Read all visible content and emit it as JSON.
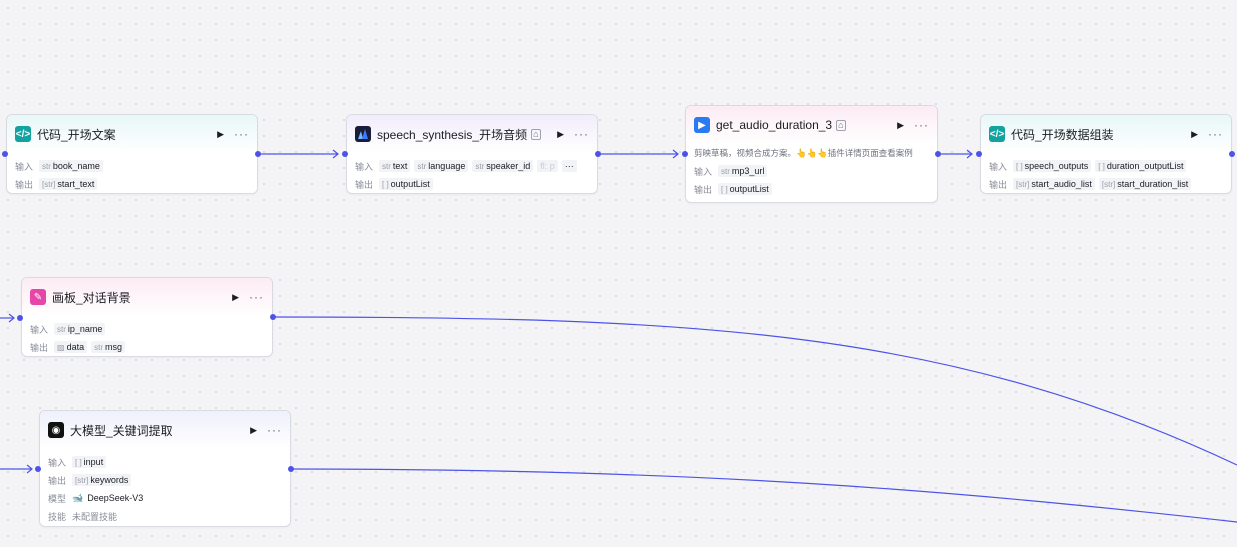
{
  "colors": {
    "edge": "#4d53e8",
    "teal": "#12a3a1",
    "pink": "#e845a8",
    "blue": "#2a7bf2"
  },
  "nodes": {
    "code_opening_text": {
      "title": "代码_开场文案",
      "icon": "code-icon",
      "input_label": "输入",
      "output_label": "输出",
      "inputs": [
        {
          "type": "str",
          "name": "book_name"
        }
      ],
      "outputs": [
        {
          "type": "[str]",
          "name": "start_text"
        }
      ]
    },
    "speech_synthesis": {
      "title": "speech_synthesis_开场音频",
      "icon": "plugin-icon",
      "input_label": "输入",
      "output_label": "输出",
      "inputs": [
        {
          "type": "str",
          "name": "text"
        },
        {
          "type": "str",
          "name": "language"
        },
        {
          "type": "str",
          "name": "speaker_id"
        },
        {
          "type": "",
          "name": "fl: p"
        }
      ],
      "inputs_more": "···",
      "outputs": [
        {
          "type": "[ ]",
          "name": "outputList"
        }
      ]
    },
    "get_audio_duration": {
      "title": "get_audio_duration_3",
      "icon": "play-icon",
      "description": "剪映草稿，视频合成方案。👆👆👆插件详情页面查看案例",
      "input_label": "输入",
      "output_label": "输出",
      "inputs": [
        {
          "type": "str",
          "name": "mp3_url"
        }
      ],
      "outputs": [
        {
          "type": "[ ]",
          "name": "outputList"
        }
      ]
    },
    "code_opening_data": {
      "title": "代码_开场数据组装",
      "icon": "code-icon",
      "input_label": "输入",
      "output_label": "输出",
      "inputs": [
        {
          "type": "[ ]",
          "name": "speech_outputs"
        },
        {
          "type": "[ ]",
          "name": "duration_outputList"
        }
      ],
      "outputs": [
        {
          "type": "[str]",
          "name": "start_audio_list"
        },
        {
          "type": "[str]",
          "name": "start_duration_list"
        }
      ]
    },
    "canvas_background": {
      "title": "画板_对话背景",
      "icon": "canvas-icon",
      "input_label": "输入",
      "output_label": "输出",
      "inputs": [
        {
          "type": "str",
          "name": "ip_name"
        }
      ],
      "outputs": [
        {
          "type": "",
          "name": "data"
        },
        {
          "type": "str",
          "name": "msg"
        }
      ]
    },
    "llm_keywords": {
      "title": "大模型_关键词提取",
      "icon": "llm-icon",
      "input_label": "输入",
      "output_label": "输出",
      "model_label": "模型",
      "skill_label": "技能",
      "inputs": [
        {
          "type": "[ ]",
          "name": "input"
        }
      ],
      "outputs": [
        {
          "type": "[str]",
          "name": "keywords"
        }
      ],
      "model": "DeepSeek-V3",
      "skill": "未配置技能"
    }
  }
}
